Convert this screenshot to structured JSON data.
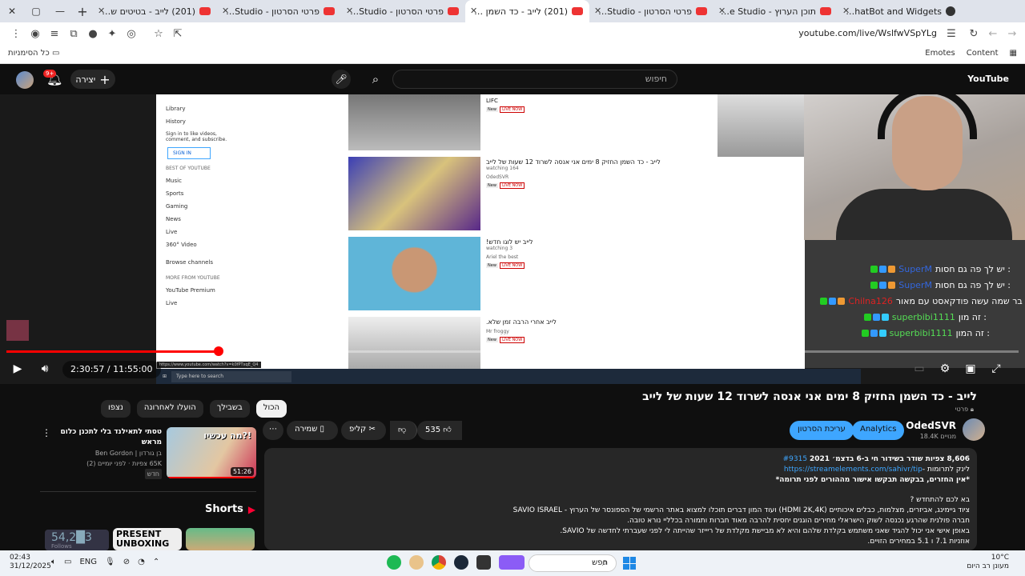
{
  "browser": {
    "tabs": [
      {
        "title": "The best ChatBot and Widgets",
        "icon": "chatgpt-icon",
        "active": false
      },
      {
        "title": "תוכן הערוץ - YouTube Studio",
        "icon": "youtube-icon",
        "active": false
      },
      {
        "title": "פרטי הסרטון - YouTube Studio",
        "icon": "youtube-icon",
        "active": false
      },
      {
        "title": "(201) לייב - כד השמן החזיק 8 ימ",
        "icon": "youtube-icon",
        "active": true
      },
      {
        "title": "פרטי הסרטון - YouTube Studio",
        "icon": "youtube-icon",
        "active": false
      },
      {
        "title": "פרטי הסרטון - YouTube Studio",
        "icon": "youtube-icon",
        "active": false
      },
      {
        "title": "(201) לייב - בטיטים של האינדי",
        "icon": "youtube-icon",
        "active": false
      }
    ],
    "url": "youtube.com/live/WslfwVSpYLg",
    "bookmarks_all": "כל הסימניות",
    "bookmarks_right": [
      "Emotes",
      "Content"
    ]
  },
  "header": {
    "notif_count": "9+",
    "create_label": "יצירה",
    "search_placeholder": "חיפוש",
    "logo": "YouTube"
  },
  "stream": {
    "side_nav": [
      "Library",
      "History"
    ],
    "signin_text": "Sign in to like videos, comment, and subscribe.",
    "signin_button": "SIGN IN",
    "best_of_heading": "BEST OF YOUTUBE",
    "best_of_items": [
      "Music",
      "Sports",
      "Gaming",
      "News",
      "Live",
      "360° Video"
    ],
    "browse_channels": "Browse channels",
    "more_heading": "MORE FROM YOUTUBE",
    "more_items": [
      "YouTube Premium",
      "Live"
    ],
    "feed": [
      {
        "channel": "LIFC",
        "title": "",
        "watching": "",
        "live": "LIVE NOW",
        "new": "New"
      },
      {
        "title": "לייב - כד השמן החזיק 8 ימים אני אנסה לשרוד 12 שעות של לייב",
        "watching": "164 watching",
        "channel": "OdedSVR",
        "live": "LIVE NOW",
        "new": "New"
      },
      {
        "title": "לייב יש לוגו חדש!",
        "watching": "3 watching",
        "channel": "Ariel the best",
        "live": "LIVE NOW",
        "new": "New"
      },
      {
        "title": "לייב אחרי הרבה זמן שלא.",
        "watching": "",
        "channel": "Mr froggy",
        "live": "LIVE NOW",
        "new": "New"
      }
    ],
    "chat": [
      {
        "user": "SuperM",
        "msg": "יש לך פה גם חסות :",
        "color": "blue"
      },
      {
        "user": "SuperM",
        "msg": "יש לך פה גם חסות :",
        "color": "blue"
      },
      {
        "user": "Chilna126",
        "msg": "בר שמה עשה פודקאסט עם מאור :",
        "color": "red"
      },
      {
        "user": "superbibi1111",
        "msg": "זה מון :",
        "color": "green"
      },
      {
        "user": "superbibi1111",
        "msg": "זה המון :",
        "color": "green"
      }
    ],
    "win_search": "Type here to search",
    "tooltip_url": "https://www.youtube.com/watch?v=k0fPTxqE_Q4"
  },
  "player": {
    "current_time": "2:30:57",
    "duration": "11:55:00",
    "progress_fraction": 0.21
  },
  "video": {
    "title": "לייב - כד השמן החזיק 8 ימים אני אנסה לשרוד 12 שעות של לייב",
    "privacy": "פרטי",
    "channel": "OdedSVR",
    "subs": "18.4K מנויים",
    "analytics": "Analytics",
    "edit_video": "עריכת הסרטון",
    "likes": "535",
    "clip": "קליפ",
    "save": "שמירה"
  },
  "description": {
    "stats": "8,606 צפיות שודר בשידור חי ב-6 בדצמ׳ 2021",
    "hashtag": "#9315",
    "tip_label": "לינק לתרומות -",
    "tip_link": "https://streamelements.com/sahivr/tip",
    "line3": "*אין החזרים, בבקשה תבקשו אישור מההורים לפני תרומה*",
    "line4": "בא לכם להתחדש ?",
    "line5": "ציוד גיימינג, אביזרים, מצלמות, כבלים איכותיים (HDMI 2K,4K) ועוד המון דברים תוכלו למצוא באתר הרשמי של הספונסר של הערוץ - SAVIO ISRAEL",
    "line6": "חברה פולנית שהרגע נכנסה לשוק הישראלי מחירים הוגנים יחסית להרבה מאוד חברות ותמורה בכלליי נורא טובה.",
    "line7": "באופן אישי אני יכול להגיד שאני משתמש בקלדת שלהם והיא לא מביישת מקלדת של ריייזר שהייתה לי לפני שעברתי לחדשה של SAVIO.",
    "line8": "אוזניות 7.1 ו 5.1 במחירים הזויים."
  },
  "filters": [
    "הכול",
    "בשבילך",
    "הועלו לאחרונה",
    "נצפו"
  ],
  "suggested": {
    "title": "טסתי לתאילנד בלי לתכנן כלום מראש",
    "channel": "בן גורדון | Ben Gordon",
    "meta": "65K צפיות · לפני יומיים (2)",
    "badge": "חדש",
    "duration": "51:26",
    "thumb_text": "מה עכשיו?!"
  },
  "shorts": {
    "heading": "Shorts",
    "follow_count": "54,2█3",
    "follow_label": "Follows",
    "short_text": "PRESENT UNBOXING"
  },
  "taskbar": {
    "time": "02:43",
    "date": "31/12/2025",
    "lang": "ENG",
    "search": "חפש",
    "temp": "10°C",
    "weather": "מעונן רב היום"
  }
}
